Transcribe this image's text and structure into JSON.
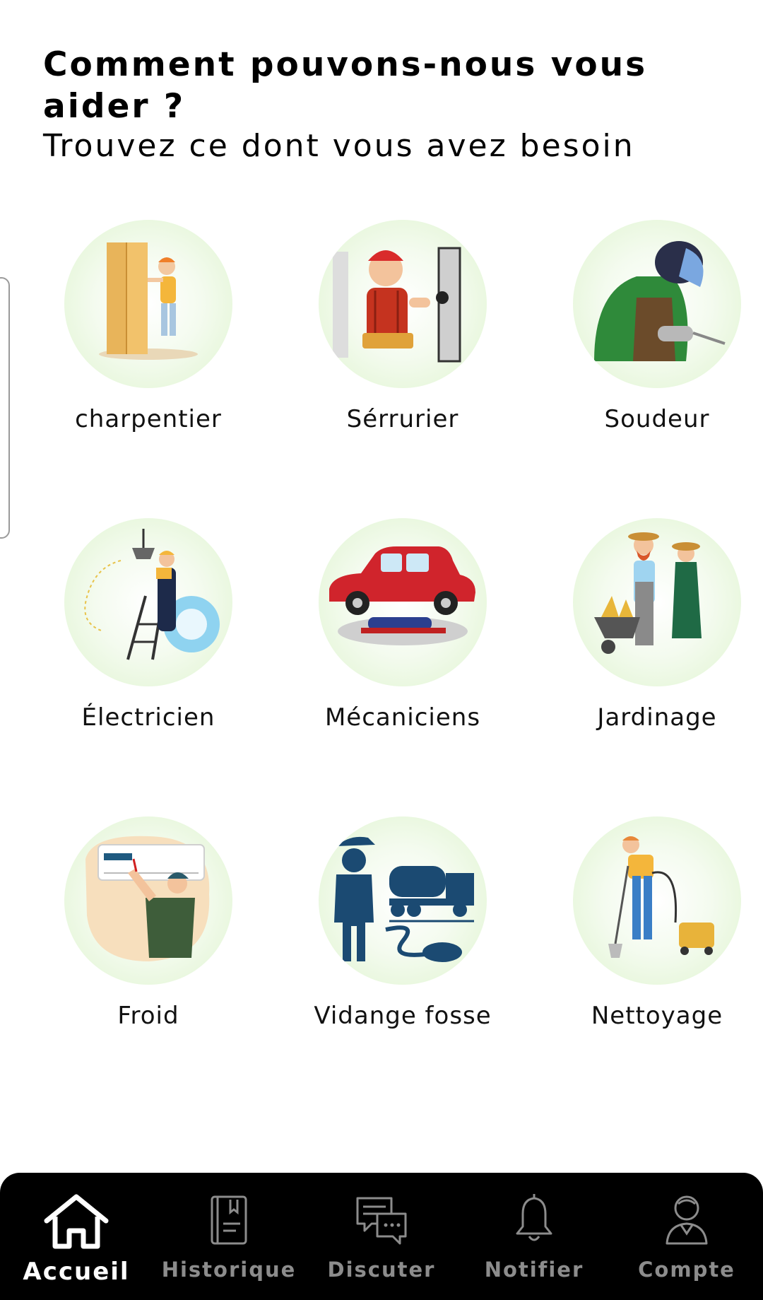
{
  "header": {
    "title": "Comment pouvons-nous vous aider ?",
    "subtitle": "Trouvez ce dont vous avez besoin"
  },
  "services": [
    {
      "label": "charpentier",
      "icon": "carpenter-icon"
    },
    {
      "label": "Sérrurier",
      "icon": "locksmith-icon"
    },
    {
      "label": "Soudeur",
      "icon": "welder-icon"
    },
    {
      "label": "Électricien",
      "icon": "electrician-icon"
    },
    {
      "label": "Mécaniciens",
      "icon": "mechanic-icon"
    },
    {
      "label": "Jardinage",
      "icon": "gardening-icon"
    },
    {
      "label": "Froid",
      "icon": "air-conditioning-icon"
    },
    {
      "label": "Vidange fosse",
      "icon": "septic-truck-icon"
    },
    {
      "label": "Nettoyage",
      "icon": "cleaning-icon"
    }
  ],
  "nav": [
    {
      "label": "Accueil",
      "icon": "home-icon",
      "active": true
    },
    {
      "label": "Historique",
      "icon": "history-book-icon",
      "active": false
    },
    {
      "label": "Discuter",
      "icon": "chat-icon",
      "active": false
    },
    {
      "label": "Notifier",
      "icon": "bell-icon",
      "active": false
    },
    {
      "label": "Compte",
      "icon": "user-icon",
      "active": false
    }
  ],
  "colors": {
    "background": "#ffffff",
    "navbar": "#000000",
    "nav_active": "#ffffff",
    "nav_inactive": "#8c8c8c",
    "circle_tint": "#dff4cf"
  }
}
